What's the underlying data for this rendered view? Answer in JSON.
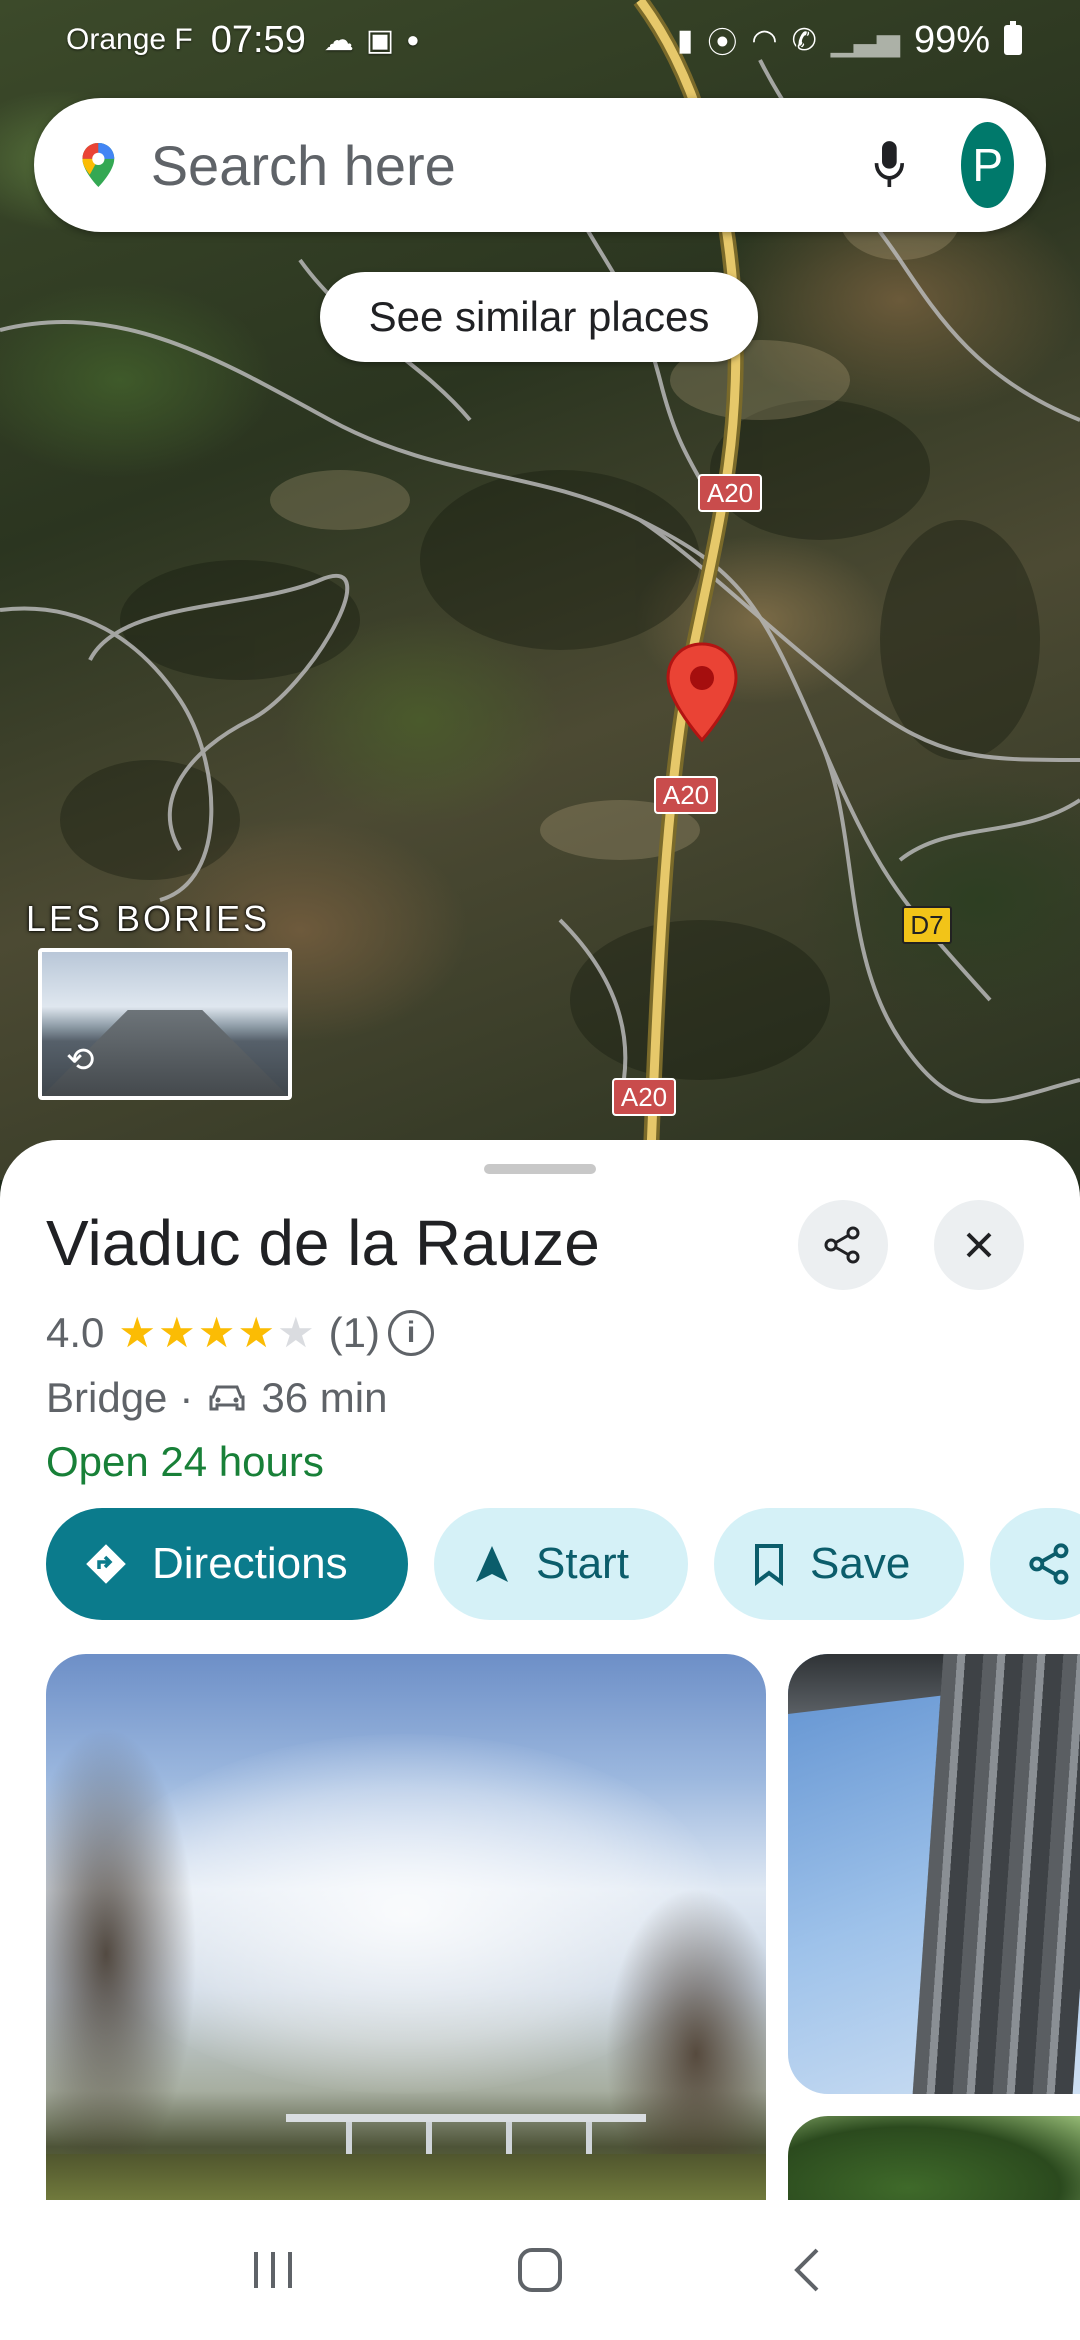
{
  "status_bar": {
    "carrier": "Orange F",
    "time": "07:59",
    "battery": "99%"
  },
  "search": {
    "placeholder": "Search here",
    "avatar_letter": "P"
  },
  "map": {
    "similar_places_chip": "See similar places",
    "place_label": "LES BORIES",
    "road_labels": {
      "a20_1": "A20",
      "a20_2": "A20",
      "a20_3": "A20",
      "d7": "D7"
    }
  },
  "place": {
    "name": "Viaduc de la Rauze",
    "rating": "4.0",
    "rating_value": 4,
    "review_count": "(1)",
    "category": "Bridge",
    "separator": "·",
    "drive_time": "36 min",
    "hours_status": "Open 24 hours"
  },
  "actions": {
    "directions": "Directions",
    "start": "Start",
    "save": "Save"
  },
  "colors": {
    "accent": "#0b7b8c",
    "accent_light": "#d5f1f7",
    "open_green": "#188038",
    "star": "#fbbc04",
    "pin": "#ea4335"
  }
}
